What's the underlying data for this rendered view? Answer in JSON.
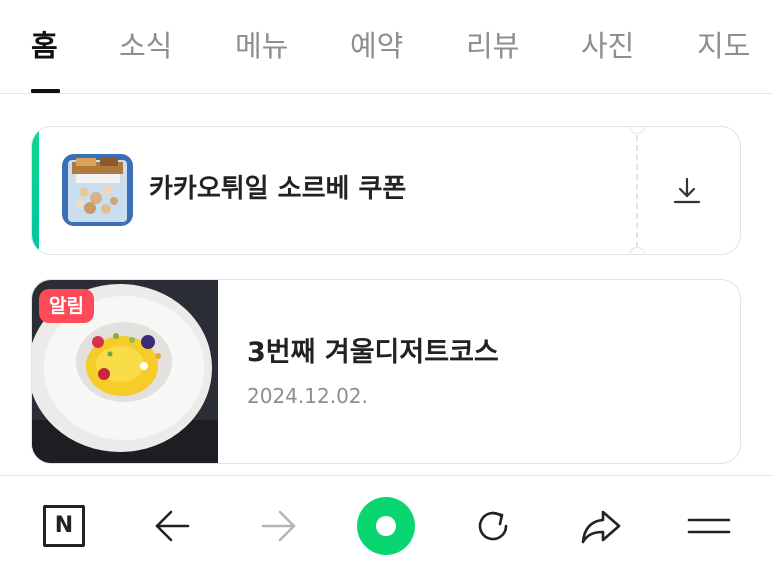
{
  "tabs": [
    {
      "label": "홈",
      "active": true
    },
    {
      "label": "소식",
      "active": false
    },
    {
      "label": "메뉴",
      "active": false
    },
    {
      "label": "예약",
      "active": false
    },
    {
      "label": "리뷰",
      "active": false
    },
    {
      "label": "사진",
      "active": false
    },
    {
      "label": "지도",
      "active": false
    }
  ],
  "coupon": {
    "title": "카카오튀일 소르베 쿠폰",
    "accent_color": "#0fd889",
    "download_icon": "download-icon",
    "thumb_icon": "dessert-bag-thumbnail"
  },
  "news": {
    "badge": "알림",
    "badge_color": "#ff4a5a",
    "title": "3번째 겨울디저트코스",
    "date": "2024.12.02."
  },
  "toolbar": {
    "home_label": "N",
    "icons": [
      "naver-home-icon",
      "back-arrow-icon",
      "forward-arrow-icon",
      "green-dot-icon",
      "refresh-icon",
      "share-icon",
      "menu-icon"
    ],
    "brand_color": "#0ad671"
  }
}
